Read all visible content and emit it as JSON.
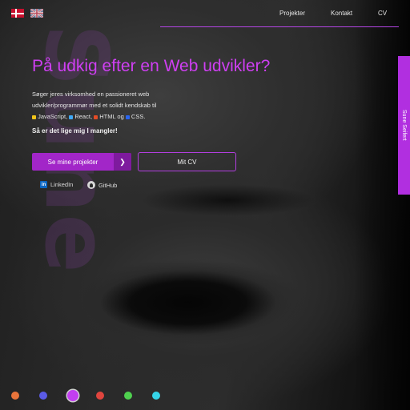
{
  "background_word": "Sune",
  "header": {
    "languages": [
      {
        "name": "danish",
        "icon": "denmark-flag-icon"
      },
      {
        "name": "english",
        "icon": "uk-flag-icon"
      }
    ],
    "nav": [
      "Projekter",
      "Kontakt",
      "CV"
    ]
  },
  "hero": {
    "title": "På udkig efter en Web udvikler?",
    "intro_line1": "Søger jeres virksomhed en passioneret web",
    "intro_line2": "udvikler/programmør med et solidt kendskab til",
    "tech": [
      {
        "label": "JavaScript",
        "color": "#f0c419",
        "sep": ","
      },
      {
        "label": "React",
        "color": "#3fa9f5",
        "sep": ","
      },
      {
        "label": "HTML",
        "color": "#e34c26",
        "sep": " og"
      },
      {
        "label": "CSS",
        "color": "#2965f1",
        "sep": "."
      }
    ],
    "cta": "Så er det lige mig I mangler!",
    "primary_button": "Se mine projekter",
    "secondary_button": "Mit CV",
    "social": [
      {
        "label": "LinkedIn",
        "icon": "linkedin-icon"
      },
      {
        "label": "GitHub",
        "icon": "github-icon"
      }
    ]
  },
  "side_tab": "Sune Seifert",
  "theme_colors": [
    "#e8743b",
    "#5b5be6",
    "#c23ff0",
    "#e0453e",
    "#4fd14f",
    "#35d4e8"
  ],
  "active_theme": 2,
  "accent_color": "#b12fe0"
}
